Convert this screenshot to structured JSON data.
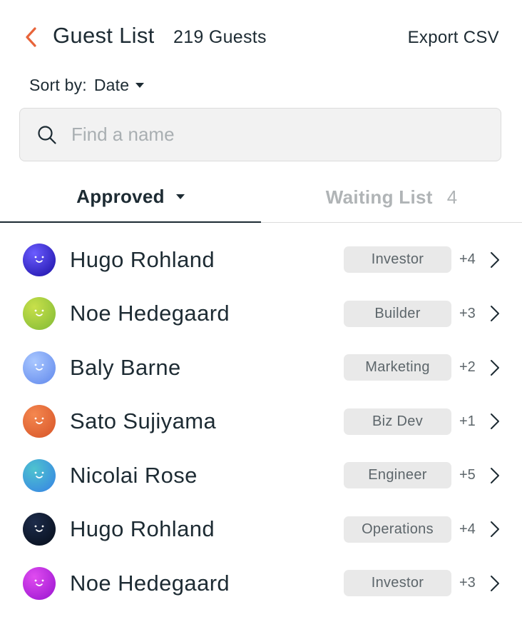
{
  "header": {
    "back_icon": "chevron-left-icon",
    "title": "Guest List",
    "count": "219 Guests",
    "export_label": "Export CSV"
  },
  "sort": {
    "label": "Sort by:",
    "value": "Date"
  },
  "search": {
    "placeholder": "Find a name",
    "value": ""
  },
  "tabs": {
    "approved": {
      "label": "Approved"
    },
    "waiting": {
      "label": "Waiting List",
      "count": "4"
    }
  },
  "colors": {
    "accent": "#e8643a",
    "text": "#1d2b33",
    "muted": "#b0b4b6",
    "tag_bg": "#e9e9e9"
  },
  "guests": [
    {
      "name": "Hugo Rohland",
      "tag": "Investor",
      "plus": "+4",
      "avatar_colors": [
        "#6b5cff",
        "#2b1fb8"
      ]
    },
    {
      "name": "Noe Hedegaard",
      "tag": "Builder",
      "plus": "+3",
      "avatar_colors": [
        "#c8e04a",
        "#8fc23a"
      ]
    },
    {
      "name": "Baly Barne",
      "tag": "Marketing",
      "plus": "+2",
      "avatar_colors": [
        "#a9c7ff",
        "#6f95f0"
      ]
    },
    {
      "name": "Sato Sujiyama",
      "tag": "Biz Dev",
      "plus": "+1",
      "avatar_colors": [
        "#f4874f",
        "#dd5f30"
      ]
    },
    {
      "name": "Nicolai Rose",
      "tag": "Engineer",
      "plus": "+5",
      "avatar_colors": [
        "#4ec3cf",
        "#3b8fe0"
      ]
    },
    {
      "name": "Hugo Rohland",
      "tag": "Operations",
      "plus": "+4",
      "avatar_colors": [
        "#1c2b4a",
        "#0b1424"
      ]
    },
    {
      "name": "Noe Hedegaard",
      "tag": "Investor",
      "plus": "+3",
      "avatar_colors": [
        "#e04cf0",
        "#a71fd6"
      ]
    }
  ]
}
